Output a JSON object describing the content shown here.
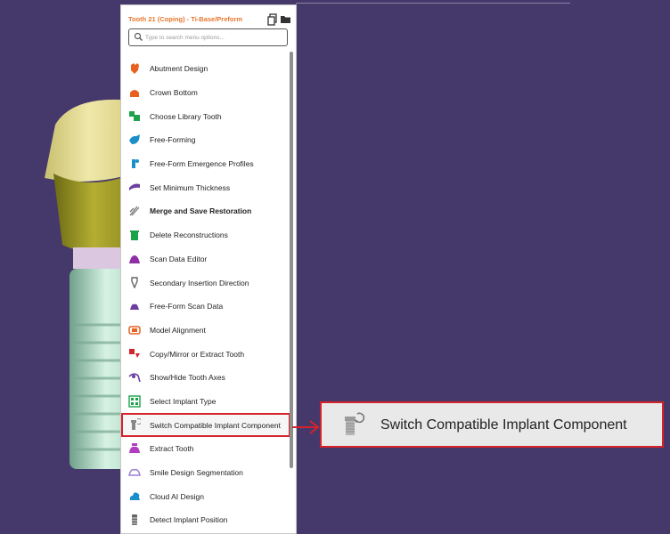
{
  "panel": {
    "title": "Tooth 21 (Coping) - Ti-Base/Preform",
    "search_placeholder": "Type to search menu options..."
  },
  "menu_items": [
    {
      "label": "Abutment Design",
      "icon": "abutment-icon",
      "color": "#e8611f"
    },
    {
      "label": "Crown Bottom",
      "icon": "crown-bottom-icon",
      "color": "#e8611f"
    },
    {
      "label": "Choose Library Tooth",
      "icon": "library-tooth-icon",
      "color": "#1aa34a"
    },
    {
      "label": "Free-Forming",
      "icon": "free-forming-icon",
      "color": "#1a8fc9"
    },
    {
      "label": "Free-Form Emergence Profiles",
      "icon": "emergence-profile-icon",
      "color": "#1a8fc9"
    },
    {
      "label": "Set Minimum Thickness",
      "icon": "thickness-icon",
      "color": "#6b3fa0"
    },
    {
      "label": "Merge and Save Restoration",
      "icon": "merge-save-icon",
      "color": "#777777",
      "bold": true
    },
    {
      "label": "Delete Reconstructions",
      "icon": "trash-icon",
      "color": "#1aa34a"
    },
    {
      "label": "Scan Data Editor",
      "icon": "scan-editor-icon",
      "color": "#8e2fa3"
    },
    {
      "label": "Secondary Insertion Direction",
      "icon": "insertion-direction-icon",
      "color": "#666666"
    },
    {
      "label": "Free-Form Scan Data",
      "icon": "free-form-scan-icon",
      "color": "#6b3fa0"
    },
    {
      "label": "Model Alignment",
      "icon": "model-alignment-icon",
      "color": "#e8611f"
    },
    {
      "label": "Copy/Mirror or Extract Tooth",
      "icon": "copy-mirror-icon",
      "color": "#d4232b"
    },
    {
      "label": "Show/Hide Tooth Axes",
      "icon": "tooth-axes-icon",
      "color": "#6b3fa0"
    },
    {
      "label": "Select Implant Type",
      "icon": "implant-type-icon",
      "color": "#1aa34a"
    },
    {
      "label": "Switch Compatible Implant Component",
      "icon": "switch-implant-icon",
      "color": "#888888",
      "highlight": true
    },
    {
      "label": "Extract Tooth",
      "icon": "extract-tooth-icon",
      "color": "#b03fc0"
    },
    {
      "label": "Smile Design Segmentation",
      "icon": "smile-design-icon",
      "color": "#9a7fd0"
    },
    {
      "label": "Cloud AI Design",
      "icon": "cloud-ai-icon",
      "color": "#1a8fc9"
    },
    {
      "label": "Detect Implant Position",
      "icon": "detect-implant-icon",
      "color": "#666666"
    }
  ],
  "zoom": {
    "label": "Switch Compatible Implant Component"
  },
  "colors": {
    "background": "#45386a",
    "accent": "#e8772e",
    "highlight": "#d4232b"
  }
}
